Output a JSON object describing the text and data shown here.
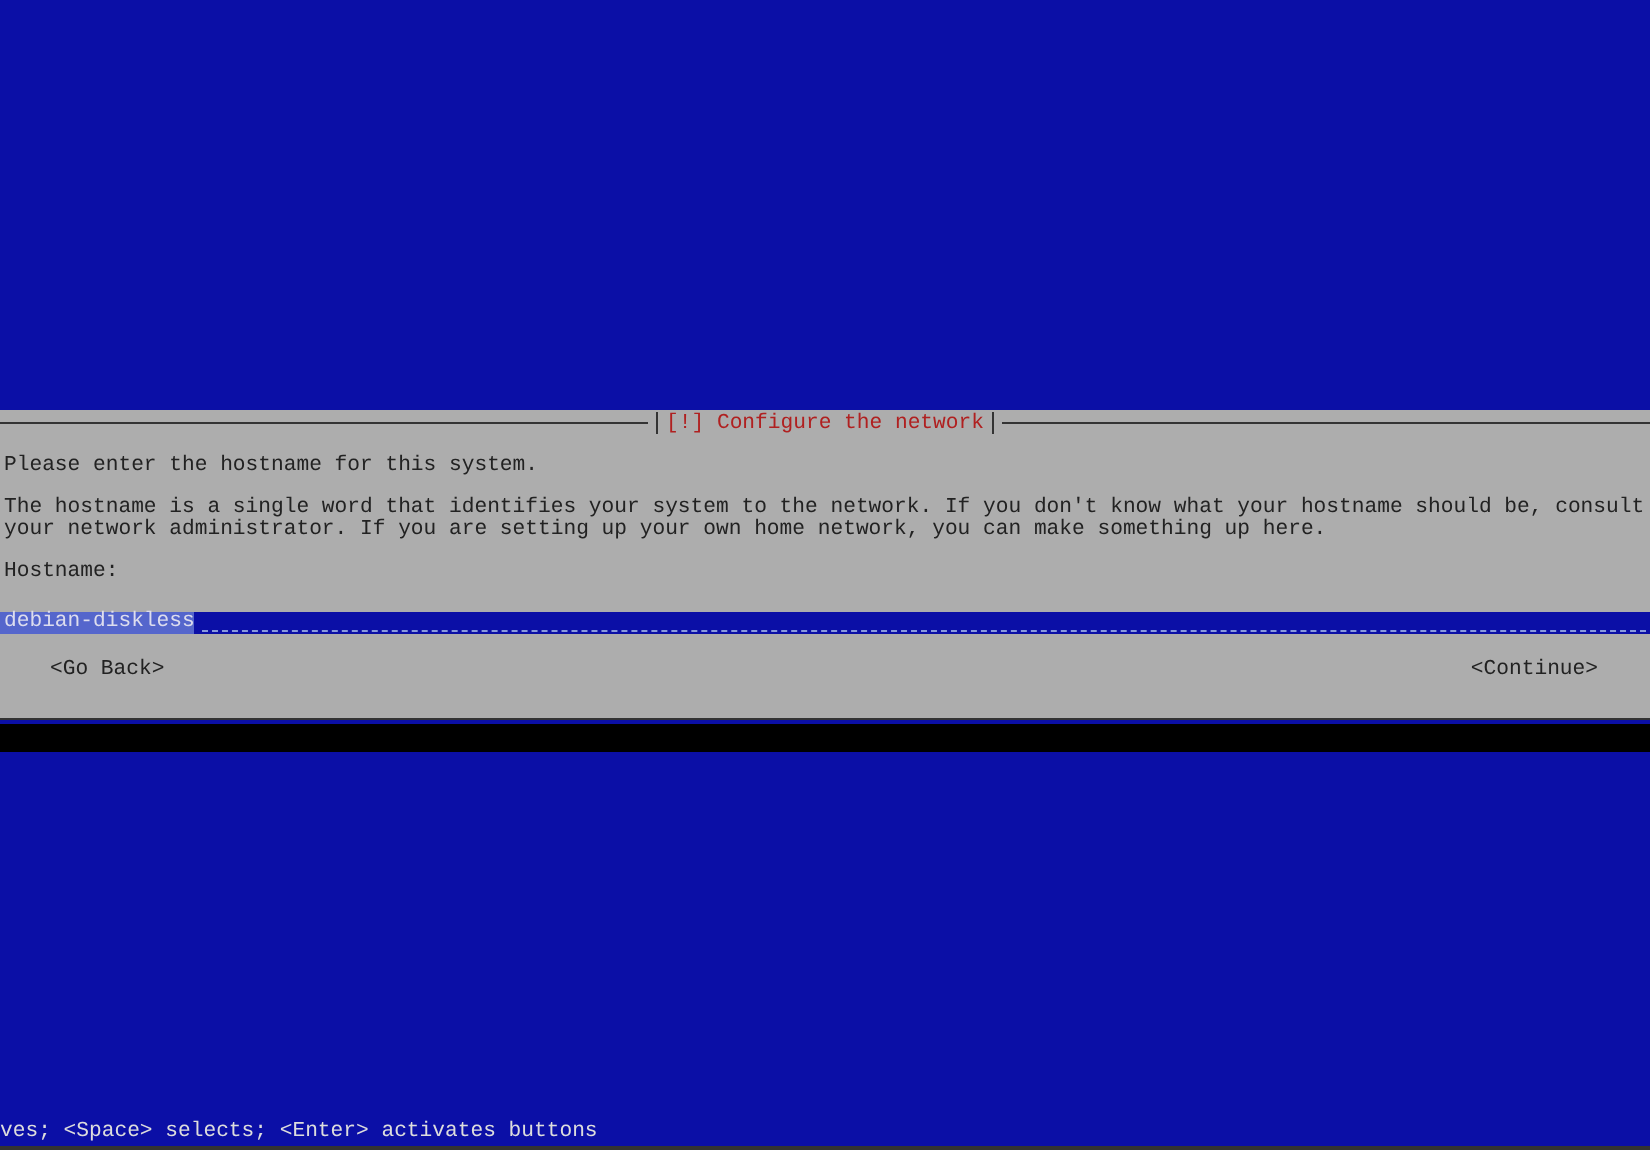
{
  "dialog": {
    "title": "[!] Configure the network",
    "prompt": "Please enter the hostname for this system.",
    "description": "The hostname is a single word that identifies your system to the network. If you don't know what your hostname should be, consult your network administrator. If you are setting up your own home network, you can make something up here.",
    "field_label": "Hostname:",
    "field": {
      "value": "debian-diskless"
    },
    "buttons": [
      {
        "label": "<Go Back>",
        "selected": false
      },
      {
        "label": "<Continue>",
        "selected": false
      }
    ]
  },
  "status_bar": "ves; <Space> selects; <Enter> activates buttons"
}
